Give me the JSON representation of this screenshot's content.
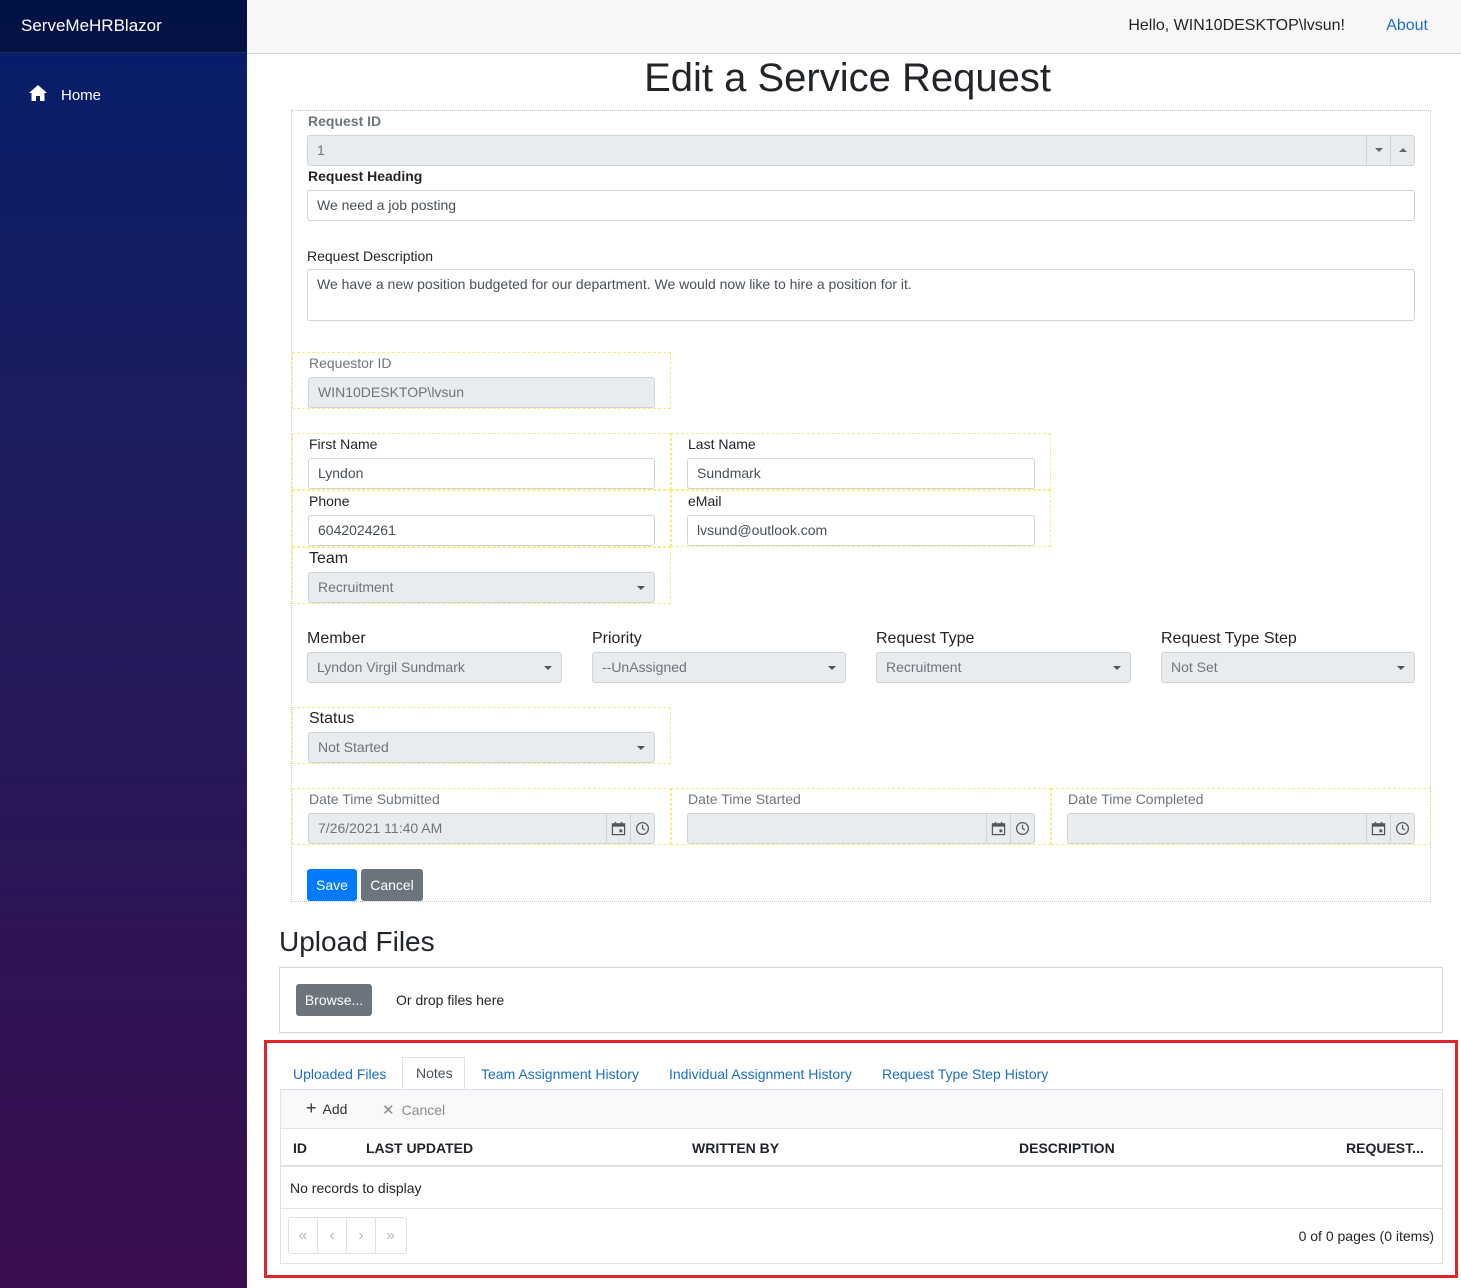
{
  "app": {
    "brand": "ServeMeHRBlazor"
  },
  "sidebar": {
    "items": [
      {
        "label": "Home",
        "icon": "home-icon"
      }
    ]
  },
  "topbar": {
    "greeting": "Hello, WIN10DESKTOP\\lvsun!",
    "about": "About"
  },
  "page": {
    "title": "Edit a Service Request"
  },
  "form": {
    "request_id": {
      "label": "Request ID",
      "value": "1"
    },
    "request_heading": {
      "label": "Request Heading",
      "value": "We need a job posting"
    },
    "request_description": {
      "label": "Request Description",
      "value": "We have a new position budgeted for our department. We would now like to hire a position for it."
    },
    "requestor_id": {
      "label": "Requestor ID",
      "value": "WIN10DESKTOP\\lvsun"
    },
    "first_name": {
      "label": "First Name",
      "value": "Lyndon"
    },
    "last_name": {
      "label": "Last Name",
      "value": "Sundmark"
    },
    "phone": {
      "label": "Phone",
      "value": "6042024261"
    },
    "email": {
      "label": "eMail",
      "value": "lvsund@outlook.com"
    },
    "team": {
      "label": "Team",
      "value": "Recruitment"
    },
    "member": {
      "label": "Member",
      "value": "Lyndon Virgil Sundmark"
    },
    "priority": {
      "label": "Priority",
      "value": "--UnAssigned"
    },
    "request_type": {
      "label": "Request Type",
      "value": "Recruitment"
    },
    "request_type_step": {
      "label": "Request Type Step",
      "value": "Not Set"
    },
    "status": {
      "label": "Status",
      "value": "Not Started"
    },
    "date_submitted": {
      "label": "Date Time Submitted",
      "value": "7/26/2021 11:40 AM"
    },
    "date_started": {
      "label": "Date Time Started",
      "value": ""
    },
    "date_completed": {
      "label": "Date Time Completed",
      "value": ""
    },
    "save_label": "Save",
    "cancel_label": "Cancel"
  },
  "upload": {
    "title": "Upload Files",
    "browse_label": "Browse...",
    "drop_text": "Or drop files here"
  },
  "tabs": [
    {
      "label": "Uploaded Files",
      "active": false
    },
    {
      "label": "Notes",
      "active": true
    },
    {
      "label": "Team Assignment History",
      "active": false
    },
    {
      "label": "Individual Assignment History",
      "active": false
    },
    {
      "label": "Request Type Step History",
      "active": false
    }
  ],
  "grid": {
    "toolbar": {
      "add_label": "Add",
      "cancel_label": "Cancel"
    },
    "columns": [
      "ID",
      "LAST UPDATED",
      "WRITTEN BY",
      "DESCRIPTION",
      "REQUEST..."
    ],
    "empty_text": "No records to display",
    "pager_buttons": [
      "«",
      "‹",
      "›",
      "»"
    ],
    "pager_info": "0 of 0 pages (0 items)"
  },
  "colors": {
    "primary": "#007bff",
    "secondary": "#6c757d",
    "link": "#1b6ec2",
    "highlight": "#e1232c"
  }
}
